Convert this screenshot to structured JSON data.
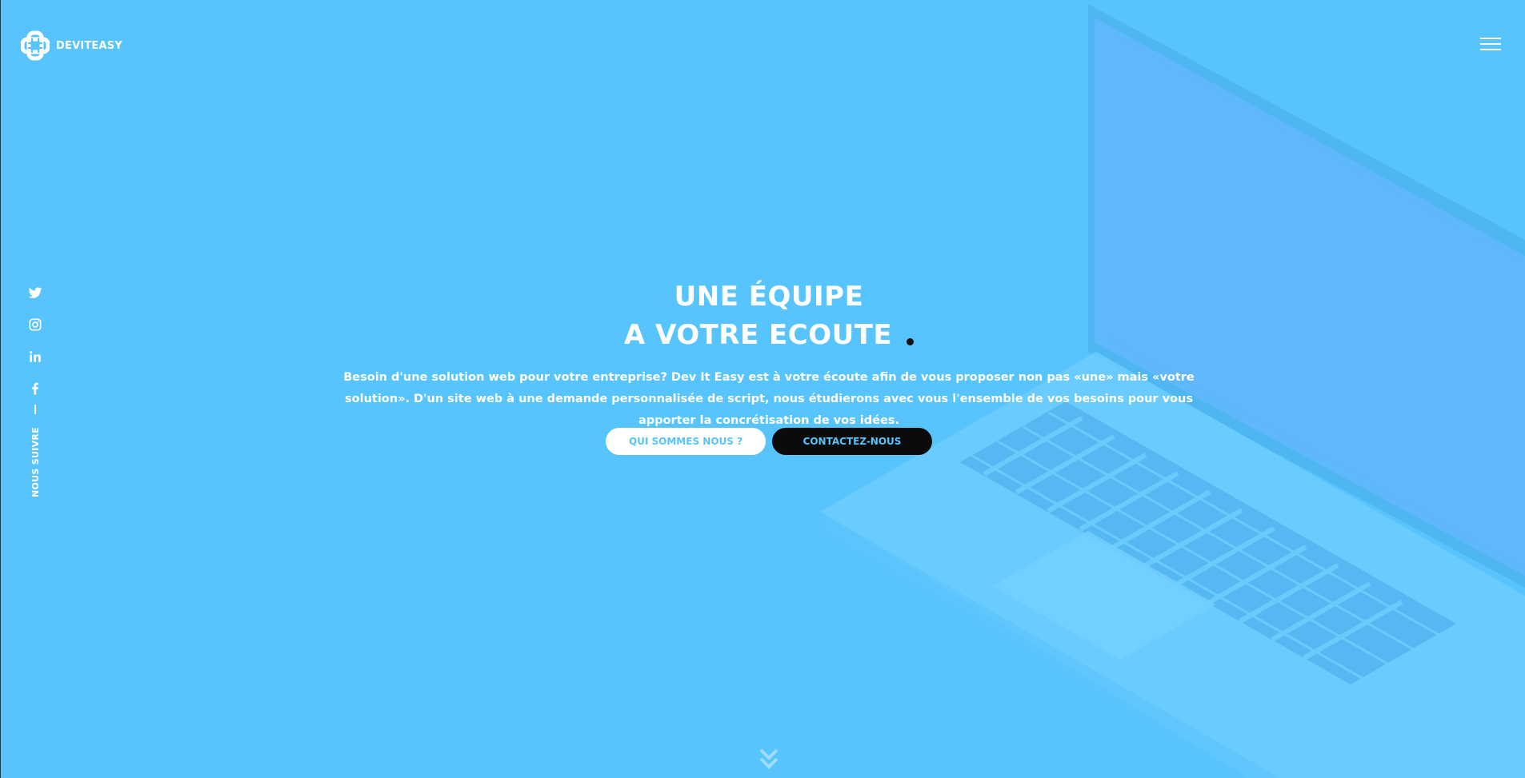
{
  "brand": {
    "name": "DEVITEASY",
    "bg_color": "#57c4fe",
    "accent_dark": "#0b0b0b"
  },
  "header": {
    "logo_icon": "hashtag-cross-logo-icon",
    "menu_icon": "hamburger-menu-icon"
  },
  "social": {
    "items": [
      {
        "name": "twitter",
        "icon": "twitter-icon"
      },
      {
        "name": "instagram",
        "icon": "instagram-icon"
      },
      {
        "name": "linkedin",
        "icon": "linkedin-icon"
      },
      {
        "name": "facebook",
        "icon": "facebook-icon"
      }
    ],
    "follow_label": "NOUS SUIVRE"
  },
  "hero": {
    "title_line1": "UNE ÉQUIPE",
    "title_line2": "A VOTRE ECOUTE",
    "description": "Besoin d'une solution web pour votre entreprise? Dev It Easy est à votre écoute afin de vous proposer non pas «une» mais «votre solution». D'un site web à une demande personnalisée de script, nous étudierons avec vous l'ensemble de vos besoins pour vous apporter la concrétisation de vos idées.",
    "primary_button": "QUI SOMMES NOUS ?",
    "secondary_button": "CONTACTEZ-NOUS",
    "scroll_icon": "double-chevron-down-icon"
  }
}
